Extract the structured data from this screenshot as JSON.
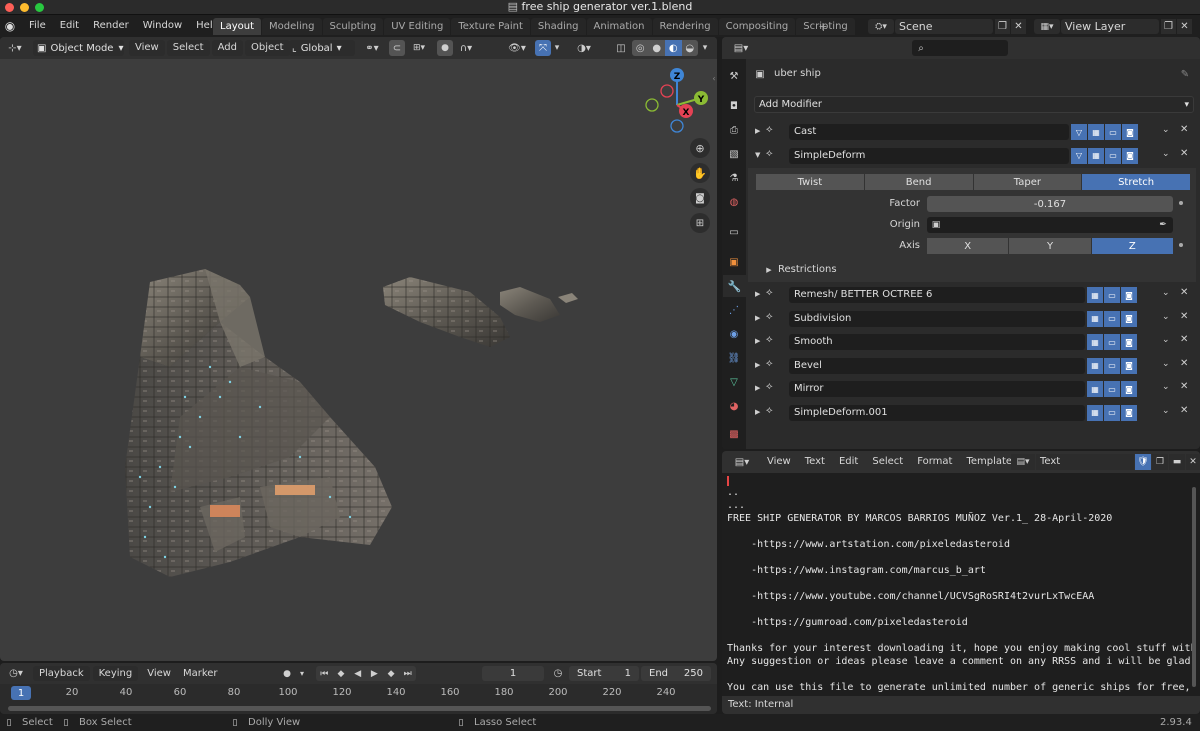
{
  "titlebar": {
    "title": "free ship generator ver.1.blend"
  },
  "menu": [
    "File",
    "Edit",
    "Render",
    "Window",
    "Help"
  ],
  "workspaces": [
    "Layout",
    "Modeling",
    "Sculpting",
    "UV Editing",
    "Texture Paint",
    "Shading",
    "Animation",
    "Rendering",
    "Compositing",
    "Scripting"
  ],
  "active_workspace": "Layout",
  "scene": {
    "name": "Scene",
    "view_layer": "View Layer"
  },
  "viewport": {
    "mode": "Object Mode",
    "menus": [
      "View",
      "Select",
      "Add",
      "Object"
    ],
    "orientation": "Global",
    "gizmo": {
      "x": "X",
      "y": "Y",
      "z": "Z"
    }
  },
  "properties": {
    "object_name": "uber ship",
    "add_modifier": "Add Modifier",
    "modifiers_top": [
      {
        "name": "Cast",
        "expanded": false
      },
      {
        "name": "SimpleDeform",
        "expanded": true
      }
    ],
    "simpledeform": {
      "methods": [
        "Twist",
        "Bend",
        "Taper",
        "Stretch"
      ],
      "active_method": "Stretch",
      "factor_label": "Factor",
      "factor_value": "-0.167",
      "origin_label": "Origin",
      "axis_label": "Axis",
      "axes": [
        "X",
        "Y",
        "Z"
      ],
      "active_axis": "Z",
      "restrictions": "Restrictions"
    },
    "modifiers_bottom": [
      "Remesh/ BETTER OCTREE 6",
      "Subdivision",
      "Smooth",
      "Bevel",
      "Mirror",
      "SimpleDeform.001"
    ]
  },
  "text_editor": {
    "menus": [
      "View",
      "Text",
      "Edit",
      "Select",
      "Format",
      "Templates"
    ],
    "file_name": "Text",
    "status": "Text: Internal",
    "lines": [
      "",
      "..",
      "...",
      "FREE SHIP GENERATOR BY MARCOS BARRIOS MUÑOZ Ver.1_ 28-April-2020",
      "",
      "    -https://www.artstation.com/pixeledasteroid",
      "",
      "    -https://www.instagram.com/marcus_b_art",
      "",
      "    -https://www.youtube.com/channel/UCVSgRoSRI4t2vurLxTwcEAA",
      "",
      "    -https://gumroad.com/pixeledasteroid",
      "",
      "Thanks for your interest downloading it, hope you enjoy making cool stuff with",
      "Any suggestion or ideas please leave a comment on any RRSS and i will be glad t",
      "",
      "You can use this file to generate unlimited number of generic ships for free, y"
    ]
  },
  "timeline": {
    "menus": [
      "Playback",
      "Keying",
      "View",
      "Marker"
    ],
    "current_frame": "1",
    "start_label": "Start",
    "start": "1",
    "end_label": "End",
    "end": "250",
    "ticks": [
      "20",
      "40",
      "60",
      "80",
      "100",
      "120",
      "140",
      "160",
      "180",
      "200",
      "220",
      "240"
    ],
    "playhead": "1"
  },
  "statusbar": {
    "select": "Select",
    "box_select": "Box Select",
    "dolly": "Dolly View",
    "lasso": "Lasso Select",
    "version": "2.93.4"
  },
  "colors": {
    "accent": "#4772b3",
    "axis_x": "#e54254",
    "axis_y": "#8bbb34",
    "axis_z": "#3f86d6"
  }
}
